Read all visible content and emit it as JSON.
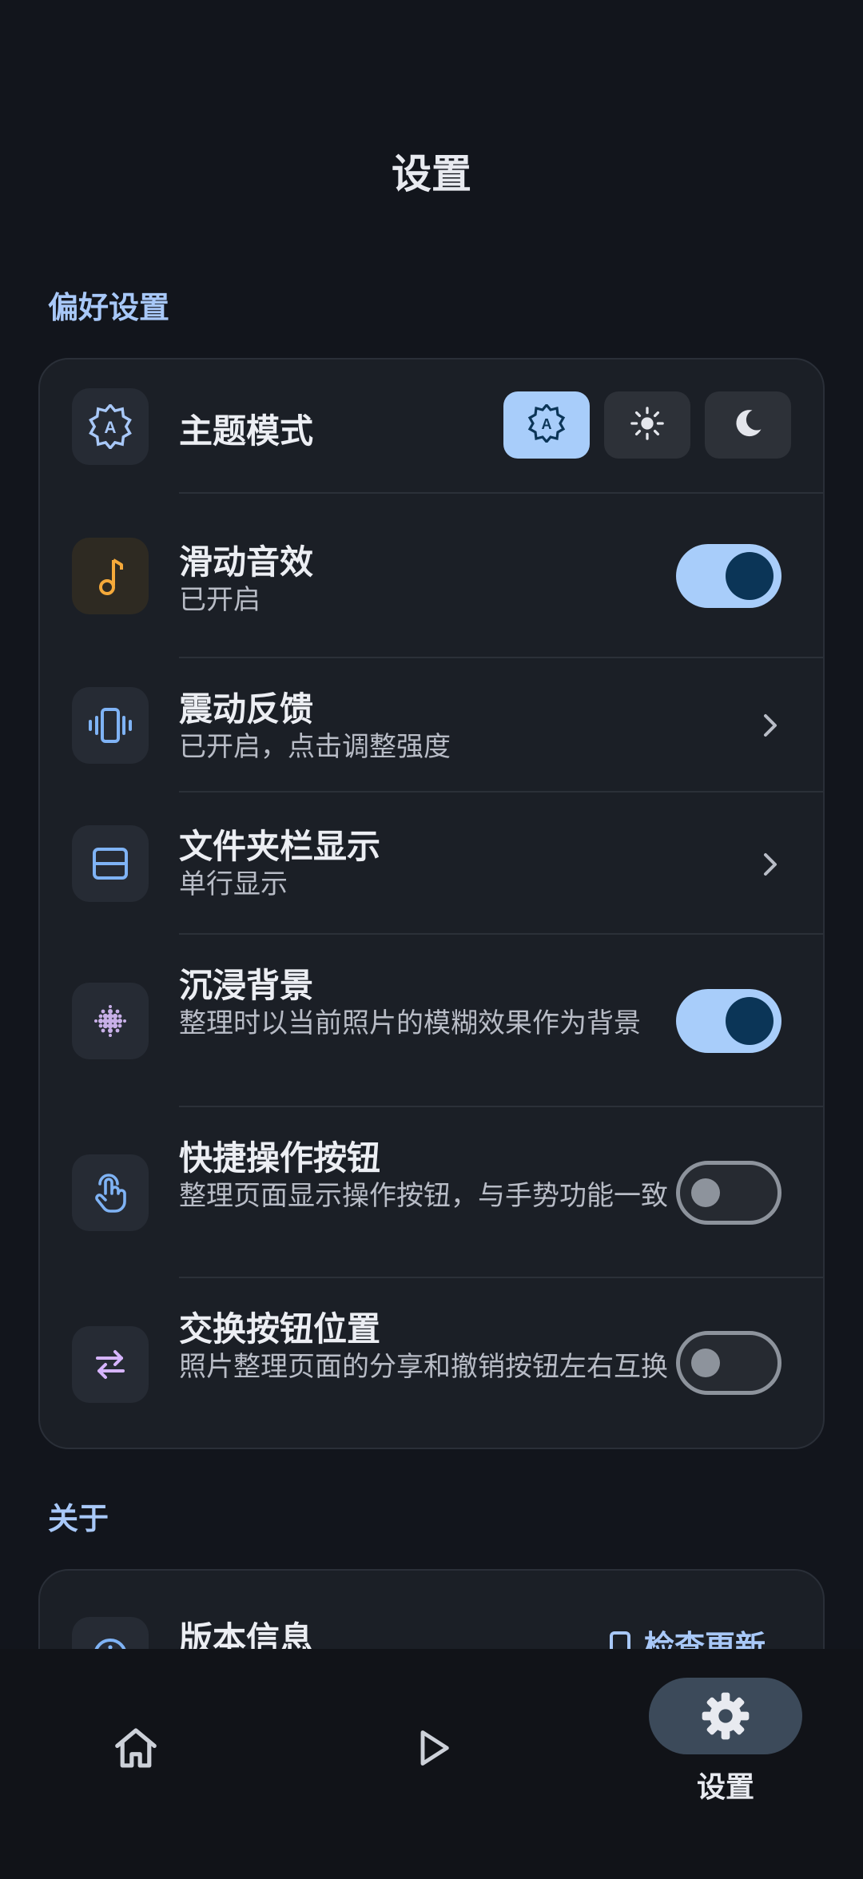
{
  "header": {
    "title": "设置"
  },
  "sections": {
    "preferences": "偏好设置",
    "about": "关于"
  },
  "preferences": {
    "theme": {
      "title": "主题模式",
      "icon": "auto-brightness-icon",
      "options": [
        {
          "icon": "auto-theme-icon",
          "selected": true
        },
        {
          "icon": "light-mode-icon",
          "selected": false
        },
        {
          "icon": "dark-mode-icon",
          "selected": false
        }
      ]
    },
    "swipe_sound": {
      "title": "滑动音效",
      "subtitle": "已开启",
      "icon": "music-note-icon",
      "enabled": true
    },
    "vibration": {
      "title": "震动反馈",
      "subtitle": "已开启，点击调整强度",
      "icon": "vibration-icon"
    },
    "folder_bar": {
      "title": "文件夹栏显示",
      "subtitle": "单行显示",
      "icon": "view-agenda-icon"
    },
    "immersive_bg": {
      "title": "沉浸背景",
      "subtitle": "整理时以当前照片的模糊效果作为背景",
      "icon": "blur-icon",
      "enabled": true
    },
    "quick_actions": {
      "title": "快捷操作按钮",
      "subtitle": "整理页面显示操作按钮，与手势功能一致",
      "icon": "touch-icon",
      "enabled": false
    },
    "swap_buttons": {
      "title": "交换按钮位置",
      "subtitle": "照片整理页面的分享和撤销按钮左右互换",
      "icon": "swap-icon",
      "enabled": false
    }
  },
  "about": {
    "version": {
      "title": "版本信息",
      "icon": "info-icon",
      "action": "检查更新"
    }
  },
  "bottom_nav": {
    "items": [
      {
        "icon": "home-icon",
        "label": ""
      },
      {
        "icon": "play-icon",
        "label": ""
      },
      {
        "icon": "gear-icon",
        "label": "设置",
        "active": true
      }
    ]
  },
  "colors": {
    "background": "#12151c",
    "card": "#1b1f26",
    "accent": "#a8cdfa",
    "section_label": "#a8c8f8",
    "music_icon": "#f5a93a",
    "swap_icon": "#d6b4ff"
  }
}
